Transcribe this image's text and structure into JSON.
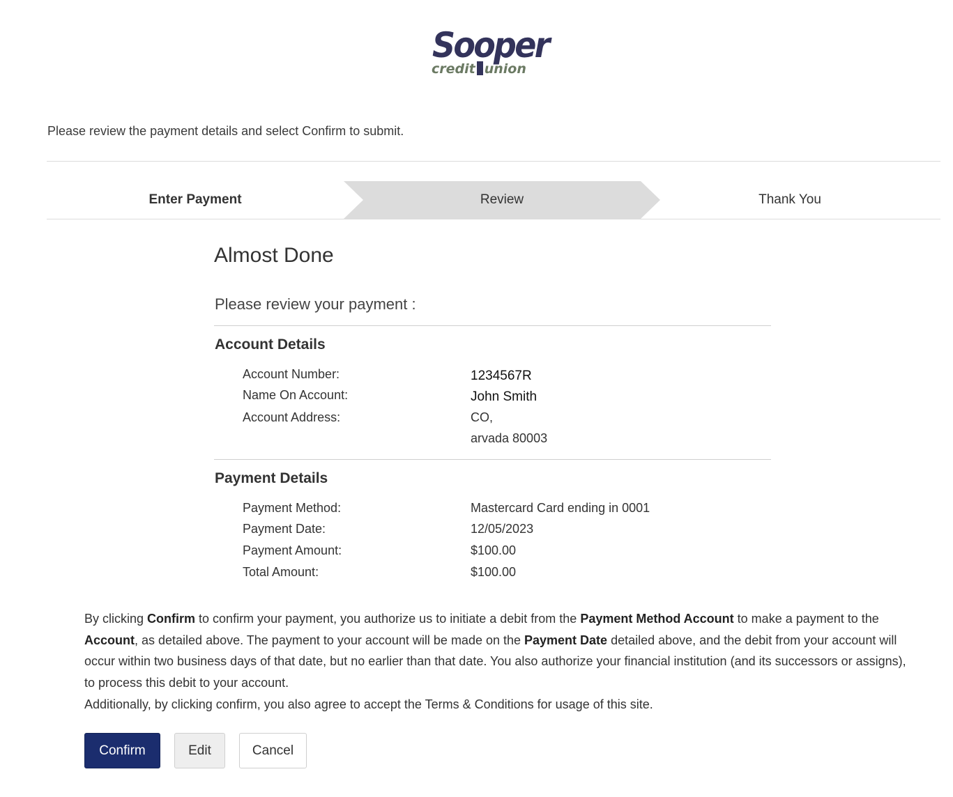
{
  "brand": {
    "name": "Sooper",
    "tagline_left": "credit",
    "tagline_right": "union"
  },
  "intro_text": "Please review the payment details and select Confirm to submit.",
  "steps": [
    {
      "label": "Enter Payment",
      "state": "done"
    },
    {
      "label": "Review",
      "state": "active"
    },
    {
      "label": "Thank You",
      "state": "pending"
    }
  ],
  "review": {
    "title": "Almost Done",
    "subtitle": "Please review your payment :",
    "account_details": {
      "heading": "Account Details",
      "rows": [
        {
          "label": "Account Number:",
          "value": "1234567R"
        },
        {
          "label": "Name On Account:",
          "value": "John Smith"
        },
        {
          "label": "Account Address:",
          "value": "CO,",
          "value2": "arvada 80003"
        }
      ]
    },
    "payment_details": {
      "heading": "Payment Details",
      "rows": [
        {
          "label": "Payment Method:",
          "value": "Mastercard Card ending in 0001"
        },
        {
          "label": "Payment Date:",
          "value": "12/05/2023"
        },
        {
          "label": "Payment Amount:",
          "value": "$100.00"
        },
        {
          "label": "Total Amount:",
          "value": "$100.00"
        }
      ]
    }
  },
  "legal": {
    "p1_a": "By clicking ",
    "p1_confirm": "Confirm",
    "p1_b": " to confirm your payment, you authorize us to initiate a debit from the ",
    "p1_method": "Payment Method Account",
    "p1_c": " to make a payment to the ",
    "p1_account": "Account",
    "p1_d": ", as detailed above. The payment to your account will be made on the ",
    "p1_date": "Payment Date",
    "p1_e": " detailed above, and the debit from your account will occur within two business days of that date, but no earlier than that date. You also authorize your financial institution (and its successors or assigns), to process this debit to your account.",
    "p2": "Additionally, by clicking confirm, you also agree to accept the Terms & Conditions for usage of this site."
  },
  "buttons": {
    "confirm": "Confirm",
    "edit": "Edit",
    "cancel": "Cancel"
  },
  "colors": {
    "brand_navy": "#33335b",
    "brand_green": "#6b7a63",
    "primary_button": "#1b2d6e",
    "step_active": "#dcdcdc"
  }
}
